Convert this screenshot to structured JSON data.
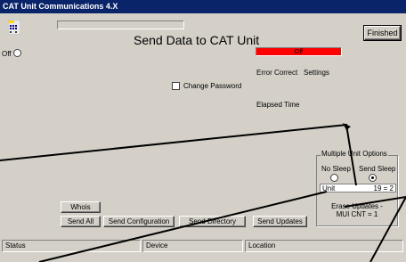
{
  "window": {
    "title": "CAT Unit Communications 4.X"
  },
  "header": {
    "title": "Send Data to CAT Unit",
    "finished_label": "Finished"
  },
  "power": {
    "state_label": "Off"
  },
  "status_indicator": {
    "text": "Off",
    "color": "#ff0000"
  },
  "labels": {
    "error_correct": "Error Correct",
    "settings": "Settings",
    "change_password": "Change Password",
    "elapsed_time": "Elapsed Time"
  },
  "multi_unit": {
    "legend": "Multiple Unit Options",
    "no_sleep": "No Sleep",
    "send_sleep": "Send Sleep",
    "selected": "Send Sleep",
    "unit_label": "Unit",
    "unit_value": "19 = 2",
    "note": "Erase Updates - MUI CNT = 1"
  },
  "buttons": {
    "whois": "Whois",
    "send_all": "Send All",
    "send_configuration": "Send Configuration",
    "send_directory": "Send Directory",
    "send_updates": "Send Updates"
  },
  "statusbar": {
    "status": "Status",
    "device": "Device",
    "location": "Location"
  },
  "colors": {
    "titlebar": "#0a246a",
    "face": "#d4d0c8",
    "indicator": "#ff0000"
  },
  "icons": {
    "app": "app-grid-icon"
  }
}
